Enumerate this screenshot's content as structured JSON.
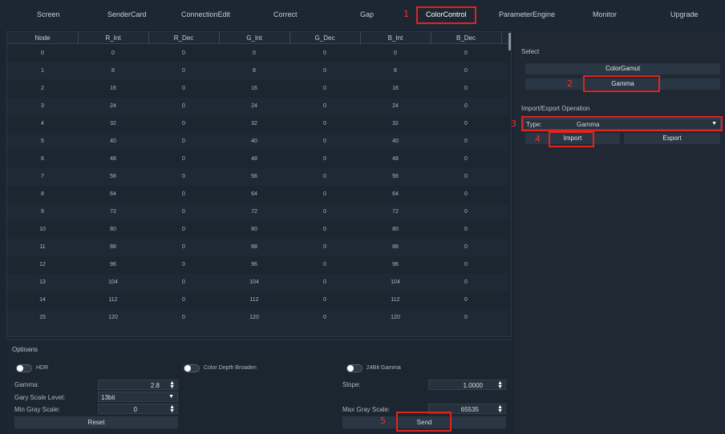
{
  "tabs": [
    "Screen",
    "SenderCard",
    "ConnectionEdit",
    "Correct",
    "Gap",
    "ColorControl",
    "ParameterEngine",
    "Monitor",
    "Upgrade"
  ],
  "active_tab": "ColorControl",
  "annotations": [
    "1",
    "2",
    "3",
    "4",
    "5"
  ],
  "annotation_color": "#ff2a2a",
  "table": {
    "columns": [
      "Node",
      "R_Int",
      "R_Dec",
      "G_Int",
      "G_Dec",
      "B_Int",
      "B_Dec"
    ],
    "rows": [
      [
        "0",
        "0",
        "0",
        "0",
        "0",
        "0",
        "0"
      ],
      [
        "1",
        "8",
        "0",
        "8",
        "0",
        "8",
        "0"
      ],
      [
        "2",
        "16",
        "0",
        "16",
        "0",
        "16",
        "0"
      ],
      [
        "3",
        "24",
        "0",
        "24",
        "0",
        "24",
        "0"
      ],
      [
        "4",
        "32",
        "0",
        "32",
        "0",
        "32",
        "0"
      ],
      [
        "5",
        "40",
        "0",
        "40",
        "0",
        "40",
        "0"
      ],
      [
        "6",
        "48",
        "0",
        "48",
        "0",
        "48",
        "0"
      ],
      [
        "7",
        "56",
        "0",
        "56",
        "0",
        "56",
        "0"
      ],
      [
        "8",
        "64",
        "0",
        "64",
        "0",
        "64",
        "0"
      ],
      [
        "9",
        "72",
        "0",
        "72",
        "0",
        "72",
        "0"
      ],
      [
        "10",
        "80",
        "0",
        "80",
        "0",
        "80",
        "0"
      ],
      [
        "11",
        "88",
        "0",
        "88",
        "0",
        "88",
        "0"
      ],
      [
        "12",
        "96",
        "0",
        "96",
        "0",
        "96",
        "0"
      ],
      [
        "13",
        "104",
        "0",
        "104",
        "0",
        "104",
        "0"
      ],
      [
        "14",
        "112",
        "0",
        "112",
        "0",
        "112",
        "0"
      ],
      [
        "15",
        "120",
        "0",
        "120",
        "0",
        "120",
        "0"
      ]
    ]
  },
  "right": {
    "select_label": "Select",
    "colorgamut_btn": "ColorGamut",
    "gamma_btn": "Gamma",
    "import_export_label": "Import/Export Operation",
    "type_label": "Type:",
    "type_value": "Gamma",
    "import_btn": "Import",
    "export_btn": "Export"
  },
  "options": {
    "title": "Optioans",
    "hdr_label": "HDR",
    "color_depth_label": "Color Depth Broaden",
    "gamma24_label": "24Bit Gamma",
    "gamma_label": "Gamma:",
    "gamma_value": "2.8",
    "slope_label": "Slope:",
    "slope_value": "1.0000",
    "gray_level_label": "Gary Scale Level:",
    "gray_level_value": "13bit",
    "min_gray_label": "Min Gray Scale:",
    "min_gray_value": "0",
    "max_gray_label": "Max Gray Scale:",
    "max_gray_value": "65535",
    "reset_btn": "Reset",
    "send_btn": "Send"
  }
}
